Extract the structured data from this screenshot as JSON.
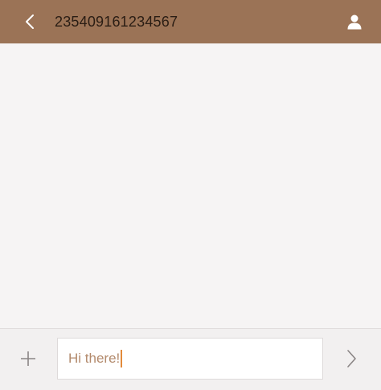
{
  "header": {
    "title": "235409161234567",
    "back_icon": "chevron-left-icon",
    "contact_icon": "person-icon",
    "background_color": "#9b7356"
  },
  "compose": {
    "attach_icon": "plus-icon",
    "input_value": "Hi there!",
    "send_icon": "chevron-right-icon",
    "caret_color": "#e28a3a",
    "text_color": "#b38a6c"
  }
}
